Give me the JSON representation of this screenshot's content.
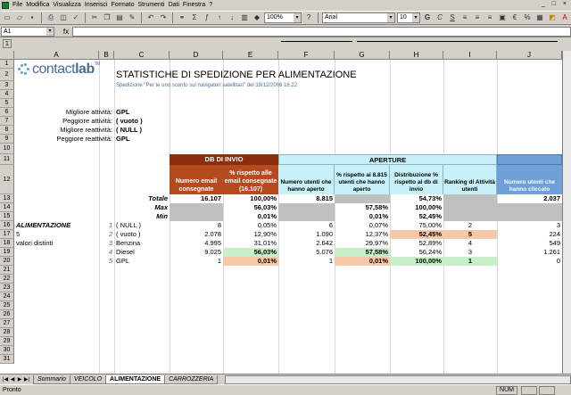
{
  "menu": [
    "File",
    "Modifica",
    "Visualizza",
    "Inserisci",
    "Formato",
    "Strumenti",
    "Dati",
    "Finestra",
    "?"
  ],
  "window_controls": "_ □ ×",
  "toolbar": {
    "zoom": "100%",
    "font": "Arial",
    "size": "10"
  },
  "formula_bar": {
    "cell_ref": "A1",
    "fx": "fx"
  },
  "outline_levels": [
    "1",
    "2"
  ],
  "columns": [
    "A",
    "B",
    "C",
    "D",
    "E",
    "F",
    "G",
    "H",
    "I",
    "J"
  ],
  "rows": [
    "1",
    "2",
    "3",
    "4",
    "5",
    "6",
    "7",
    "8",
    "9",
    "10",
    "11",
    "12",
    "13",
    "14",
    "15",
    "16",
    "17",
    "18",
    "19",
    "20",
    "21",
    "22",
    "23",
    "24",
    "25",
    "26",
    "27",
    "28",
    "29",
    "30",
    "31"
  ],
  "logo": {
    "text_a": "contact",
    "text_b": "lab",
    "tm": "TM"
  },
  "title": "STATISTICHE DI SPEDIZIONE PER ALIMENTAZIONE",
  "subtitle": "Spedizione \"Per te uno sconto sui navigatori satellitari\" del 19/12/2006 16.22",
  "summary": [
    {
      "label": "Migliore attività:",
      "value": "GPL"
    },
    {
      "label": "Peggiore attività:",
      "value": "( vuoto )"
    },
    {
      "label": "Migliore reattività:",
      "value": "( NULL )"
    },
    {
      "label": "Peggiore reattività:",
      "value": "GPL"
    }
  ],
  "headers": {
    "db_invio": "DB DI INVIO",
    "aperture": "APERTURE",
    "db_num": "Numero email consegnate",
    "db_pct": "% rispetto alle email consegnate (16.107)",
    "ap_num": "Numero utenti che hanno aperto",
    "ap_pct": "% rispetto ai 8.815 utenti che hanno aperto",
    "ap_dist": "Distribuzione % rispetto al db di invio",
    "ap_rank": "Ranking di Attività utenti",
    "cl_num": "Numero utenti che hanno cliccato"
  },
  "totals": {
    "totale_label": "Totale",
    "max_label": "Max",
    "min_label": "Min",
    "totale": {
      "d": "16.107",
      "e": "100,00%",
      "f": "8.815",
      "h": "54,73%",
      "j": "2.037"
    },
    "max": {
      "e": "56,03%",
      "g": "57,58%",
      "h": "100,00%"
    },
    "min": {
      "e": "0,01%",
      "g": "0,01%",
      "h": "52,45%"
    }
  },
  "section": {
    "label": "ALIMENTAZIONE",
    "count": "5",
    "count_label": "valori distinti"
  },
  "rows_data": [
    {
      "idx": "1",
      "name": "( NULL )",
      "d": "8",
      "e": "0,05%",
      "f": "6",
      "g": "0,07%",
      "h": "75,00%",
      "i": "2",
      "j": "3"
    },
    {
      "idx": "2",
      "name": "( vuoto )",
      "d": "2.078",
      "e": "12,90%",
      "f": "1.090",
      "g": "12,37%",
      "h": "52,45%",
      "i": "5",
      "j": "224"
    },
    {
      "idx": "3",
      "name": "Benzina",
      "d": "4.995",
      "e": "31,01%",
      "f": "2.642",
      "g": "29,97%",
      "h": "52,89%",
      "i": "4",
      "j": "549"
    },
    {
      "idx": "4",
      "name": "Diesel",
      "d": "9.025",
      "e": "56,03%",
      "f": "5.076",
      "g": "57,58%",
      "h": "56,24%",
      "i": "3",
      "j": "1.261"
    },
    {
      "idx": "5",
      "name": "GPL",
      "d": "1",
      "e": "0,01%",
      "f": "1",
      "g": "0,01%",
      "h": "100,00%",
      "i": "1",
      "j": "0"
    }
  ],
  "sheet_tabs": [
    "Sommario",
    "VEICOLO",
    "ALIMENTAZIONE",
    "CARROZZERIA"
  ],
  "active_tab": "ALIMENTAZIONE",
  "status": {
    "text": "Pronto",
    "num": "NUM"
  },
  "colors": {
    "db_header": "#8b2e0e",
    "db_sub": "#b64a1f",
    "ap_header": "#c8f0f8",
    "cl_header": "#6fa0d8",
    "orange_hl": "#f6c8a8",
    "green_hl": "#c8f0c8"
  }
}
